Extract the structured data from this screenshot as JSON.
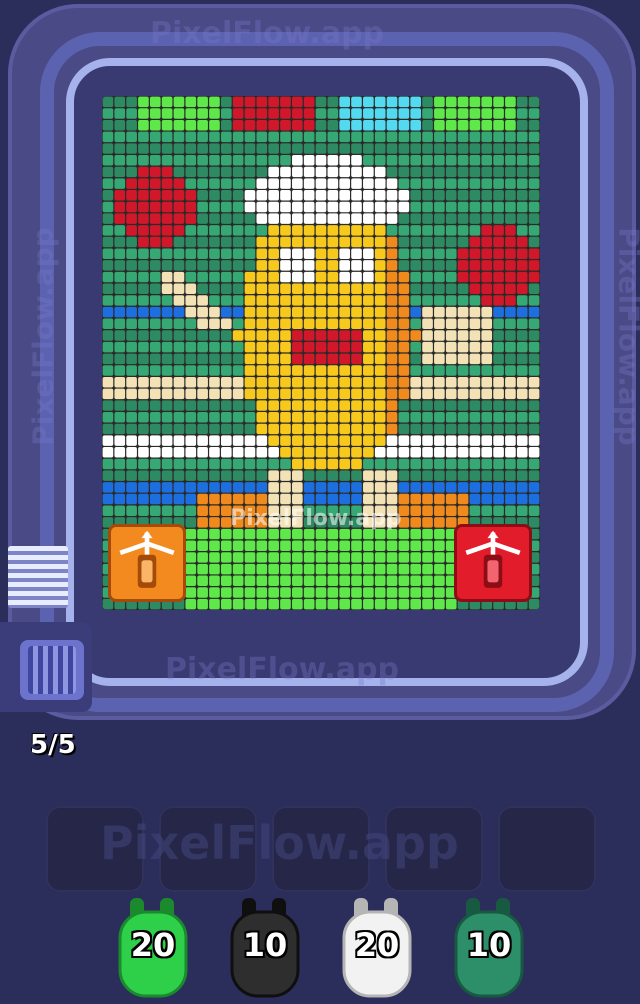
{
  "watermark": "PixelFlow.app",
  "board": {
    "cols": 37,
    "rows": 44,
    "colors": {
      "background_stripe_a": "#2d8a63",
      "background_stripe_b": "#35a874",
      "outline": "#2b2b2b",
      "body_yellow": "#f7c91c",
      "body_orange": "#f08a1c",
      "white": "#ffffff",
      "red": "#d0182a",
      "cream": "#f2e2b6",
      "blue": "#1d6fe0",
      "light_blue": "#53d9f0",
      "green": "#3bd44a",
      "light_green": "#5ee84a"
    }
  },
  "shooters": [
    {
      "name": "orange-shooter",
      "color": "#f28a1f"
    },
    {
      "name": "red-shooter",
      "color": "#e21c2a"
    }
  ],
  "progress": {
    "label": "5/5"
  },
  "slots": [
    {},
    {},
    {},
    {},
    {}
  ],
  "bunnies": [
    {
      "label": "20",
      "color": "#2ed04a",
      "dark": "#1a8a2d"
    },
    {
      "label": "10",
      "color": "#2e2e2e",
      "dark": "#0f0f0f"
    },
    {
      "label": "20",
      "color": "#f2f2f2",
      "dark": "#b5b5b5"
    },
    {
      "label": "10",
      "color": "#2c8f6a",
      "dark": "#175a41"
    }
  ]
}
